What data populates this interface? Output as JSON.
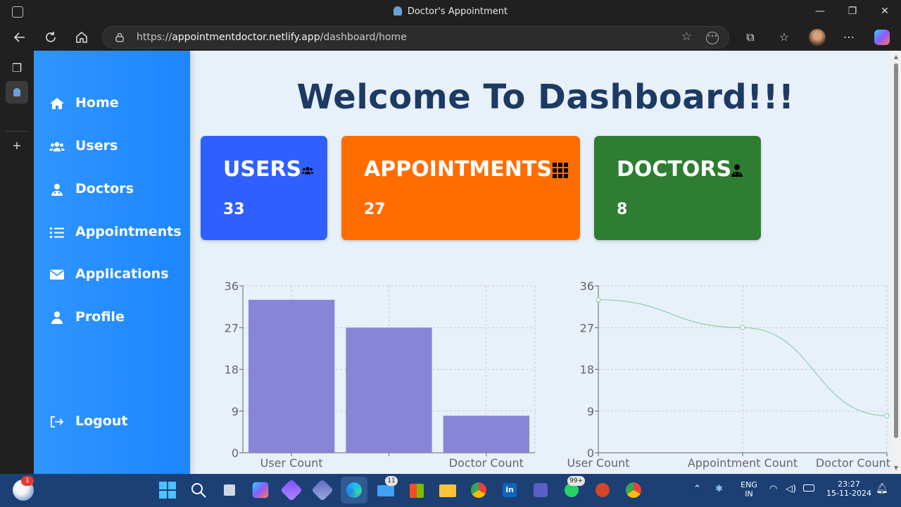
{
  "browser": {
    "window_title": "Doctor's Appointment",
    "url_prefix": "https://",
    "url_host": "appointmentdoctor.netlify.app",
    "url_path": "/dashboard/home",
    "controls": {
      "minimize": "—",
      "restore": "❐",
      "close": "✕"
    }
  },
  "sidebar": {
    "items": [
      {
        "label": "Home",
        "icon": "home-icon"
      },
      {
        "label": "Users",
        "icon": "users-icon"
      },
      {
        "label": "Doctors",
        "icon": "doctor-icon"
      },
      {
        "label": "Appointments",
        "icon": "list-icon"
      },
      {
        "label": "Applications",
        "icon": "envelope-icon"
      },
      {
        "label": "Profile",
        "icon": "user-icon"
      }
    ],
    "logout": {
      "label": "Logout",
      "icon": "logout-icon"
    }
  },
  "main": {
    "welcome": "Welcome To Dashboard!!!",
    "cards": [
      {
        "title": "USERS",
        "value": "33",
        "color": "#2f60ff",
        "icon": "users-icon"
      },
      {
        "title": "APPOINTMENTS",
        "value": "27",
        "color": "#ff6d00",
        "icon": "grid-icon"
      },
      {
        "title": "DOCTORS",
        "value": "8",
        "color": "#2e7d32",
        "icon": "doctor-icon"
      }
    ]
  },
  "chart_data": [
    {
      "type": "bar",
      "categories": [
        "User Count",
        "Appointment Count",
        "Doctor Count"
      ],
      "visible_tick_labels": [
        "User Count",
        "",
        "Doctor Count"
      ],
      "values": [
        33,
        27,
        8
      ],
      "yticks": [
        0,
        9,
        18,
        27,
        36
      ],
      "ylim": [
        0,
        36
      ],
      "grid": true,
      "bar_color": "#8884d8"
    },
    {
      "type": "line",
      "categories": [
        "User Count",
        "Appointment Count",
        "Doctor Count"
      ],
      "values": [
        33,
        27,
        8
      ],
      "yticks": [
        0,
        9,
        18,
        27,
        36
      ],
      "ylim": [
        0,
        36
      ],
      "grid": true,
      "line_color": "#82ca9d"
    }
  ],
  "taskbar": {
    "weather_badge": "1",
    "mail_badge": "11",
    "whatsapp_badge": "99+",
    "lang": "ENG",
    "region": "IN",
    "time": "23:27",
    "date": "15-11-2024"
  }
}
